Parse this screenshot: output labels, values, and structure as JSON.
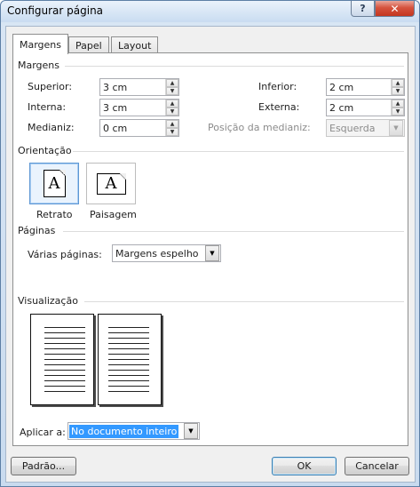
{
  "window": {
    "title": "Configurar página",
    "help_label": "?",
    "close_label": "✕"
  },
  "tabs": [
    {
      "label": "Margens",
      "active": true
    },
    {
      "label": "Papel",
      "active": false
    },
    {
      "label": "Layout",
      "active": false
    }
  ],
  "margins": {
    "section_title": "Margens",
    "superior": {
      "label": "Superior:",
      "value": "3 cm"
    },
    "inferior": {
      "label": "Inferior:",
      "value": "2 cm"
    },
    "interna": {
      "label": "Interna:",
      "value": "3 cm"
    },
    "externa": {
      "label": "Externa:",
      "value": "2 cm"
    },
    "medianiz": {
      "label": "Medianiz:",
      "value": "0 cm"
    },
    "posicao_medianiz": {
      "label": "Posição da medianiz:",
      "value": "Esquerda"
    }
  },
  "orientation": {
    "section_title": "Orientação",
    "retrato": {
      "label": "Retrato",
      "glyph": "A",
      "selected": true
    },
    "paisagem": {
      "label": "Paisagem",
      "glyph": "A",
      "selected": false
    }
  },
  "pages": {
    "section_title": "Páginas",
    "varias_label": "Várias páginas:",
    "varias_value": "Margens espelho"
  },
  "preview": {
    "section_title": "Visualização"
  },
  "apply": {
    "label": "Aplicar a:",
    "value": "No documento inteiro"
  },
  "buttons": {
    "default_label": "Padrão...",
    "ok_label": "OK",
    "cancel_label": "Cancelar"
  },
  "icons": {
    "spin_up": "spin-up-arrow",
    "spin_down": "spin-down-arrow",
    "dropdown": "dropdown-arrow"
  }
}
